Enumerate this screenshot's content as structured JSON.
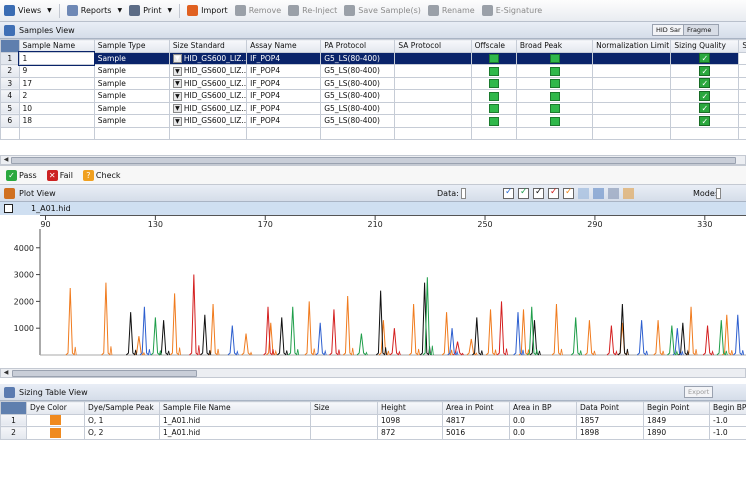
{
  "toolbar": {
    "items": [
      {
        "label": "Views",
        "icon": "views-icon",
        "color": "#3b6db3",
        "dropdown": true,
        "disabled": false
      },
      {
        "label": "Reports",
        "icon": "reports-icon",
        "color": "#6e88b5",
        "dropdown": true,
        "disabled": false
      },
      {
        "label": "Print",
        "icon": "print-icon",
        "color": "#5c6c86",
        "dropdown": true,
        "disabled": false
      },
      {
        "label": "Import",
        "icon": "import-icon",
        "color": "#e06020",
        "dropdown": false,
        "disabled": false
      },
      {
        "label": "Remove",
        "icon": "remove-icon",
        "color": "#9aa0a8",
        "dropdown": false,
        "disabled": true
      },
      {
        "label": "Re-Inject",
        "icon": "reinject-icon",
        "color": "#9aa0a8",
        "dropdown": false,
        "disabled": true
      },
      {
        "label": "Save Sample(s)",
        "icon": "save-icon",
        "color": "#9aa0a8",
        "dropdown": false,
        "disabled": true
      },
      {
        "label": "Rename",
        "icon": "rename-icon",
        "color": "#9aa0a8",
        "dropdown": false,
        "disabled": true
      },
      {
        "label": "E-Signature",
        "icon": "e-signature-icon",
        "color": "#9aa0a8",
        "dropdown": false,
        "disabled": true
      }
    ]
  },
  "samples_view": {
    "title": "Samples View",
    "hid_button": "HID Sar",
    "fragment_button": "Fragme",
    "columns": [
      "Sample Name",
      "Sample Type",
      "Size Standard",
      "Assay Name",
      "PA Protocol",
      "SA Protocol",
      "Offscale",
      "Broad Peak",
      "Normalization Limit",
      "Sizing Quality",
      "Sam"
    ],
    "rows": [
      {
        "n": "1",
        "name": "1",
        "type": "Sample",
        "std": "HID_GS600_LIZ...",
        "assay": "IF_POP4",
        "pa": "G5_LS(80-400)",
        "selected": true
      },
      {
        "n": "2",
        "name": "9",
        "type": "Sample",
        "std": "HID_GS600_LIZ...",
        "assay": "IF_POP4",
        "pa": "G5_LS(80-400)",
        "selected": false
      },
      {
        "n": "3",
        "name": "17",
        "type": "Sample",
        "std": "HID_GS600_LIZ...",
        "assay": "IF_POP4",
        "pa": "G5_LS(80-400)",
        "selected": false
      },
      {
        "n": "4",
        "name": "2",
        "type": "Sample",
        "std": "HID_GS600_LIZ...",
        "assay": "IF_POP4",
        "pa": "G5_LS(80-400)",
        "selected": false
      },
      {
        "n": "5",
        "name": "10",
        "type": "Sample",
        "std": "HID_GS600_LIZ...",
        "assay": "IF_POP4",
        "pa": "G5_LS(80-400)",
        "selected": false
      },
      {
        "n": "6",
        "name": "18",
        "type": "Sample",
        "std": "HID_GS600_LIZ...",
        "assay": "IF_POP4",
        "pa": "G5_LS(80-400)",
        "selected": false
      }
    ]
  },
  "legend": {
    "pass": "Pass",
    "fail": "Fail",
    "check": "Check",
    "pass_color": "#2aa83e",
    "fail_color": "#cc2222",
    "check_color": "#f0a020"
  },
  "plot_view": {
    "title": "Plot View",
    "data_label": "Data:",
    "mode_label": "Mode:",
    "sample_label": "1_A01.hid",
    "dye_toggle_colors": [
      "#2f6fd6",
      "#22a050",
      "#111111",
      "#d02020",
      "#f08a1e"
    ],
    "chart_data": {
      "type": "line",
      "xlabel": "",
      "ylabel": "",
      "x_ticks": [
        90,
        130,
        170,
        210,
        250,
        290,
        330
      ],
      "y_ticks": [
        1000,
        2000,
        3000,
        4000
      ],
      "xlim": [
        88,
        345
      ],
      "ylim": [
        0,
        4700
      ],
      "series": [
        {
          "color": "#f07b1e",
          "peaks": [
            [
              99,
              2500
            ],
            [
              112,
              2700
            ],
            [
              124,
              700
            ],
            [
              137,
              2300
            ],
            [
              151,
              1900
            ],
            [
              163,
              800
            ],
            [
              172,
              1200
            ],
            [
              186,
              2000
            ],
            [
              200,
              2200
            ],
            [
              213,
              1300
            ],
            [
              224,
              1900
            ],
            [
              236,
              1600
            ],
            [
              245,
              600
            ],
            [
              252,
              1700
            ],
            [
              264,
              1700
            ],
            [
              276,
              1900
            ],
            [
              288,
              1300
            ],
            [
              300,
              1200
            ],
            [
              313,
              1300
            ],
            [
              325,
              1800
            ],
            [
              338,
              1500
            ]
          ]
        },
        {
          "color": "#d42020",
          "peaks": [
            [
              144,
              3000
            ],
            [
              171,
              1800
            ],
            [
              195,
              1700
            ],
            [
              217,
              1000
            ],
            [
              240,
              500
            ],
            [
              256,
              2000
            ],
            [
              296,
              1100
            ],
            [
              331,
              1100
            ]
          ]
        },
        {
          "color": "#111111",
          "peaks": [
            [
              121,
              1600
            ],
            [
              133,
              1300
            ],
            [
              148,
              1500
            ],
            [
              176,
              1400
            ],
            [
              212,
              2400
            ],
            [
              228,
              2700
            ],
            [
              247,
              1400
            ],
            [
              268,
              1300
            ],
            [
              300,
              1900
            ],
            [
              322,
              1200
            ]
          ]
        },
        {
          "color": "#2d5fcf",
          "peaks": [
            [
              126,
              1800
            ],
            [
              158,
              1100
            ],
            [
              190,
              1200
            ],
            [
              238,
              1000
            ],
            [
              262,
              1600
            ],
            [
              307,
              1300
            ],
            [
              320,
              1000
            ],
            [
              342,
              1500
            ]
          ]
        },
        {
          "color": "#1f9e4a",
          "peaks": [
            [
              130,
              1400
            ],
            [
              180,
              1800
            ],
            [
              205,
              800
            ],
            [
              229,
              2900
            ],
            [
              267,
              1800
            ],
            [
              283,
              1400
            ],
            [
              318,
              1100
            ],
            [
              336,
              1300
            ]
          ]
        }
      ]
    }
  },
  "sizing_table": {
    "title": "Sizing Table View",
    "export": "Export",
    "columns": [
      "Dye Color",
      "Dye/Sample Peak",
      "Sample File Name",
      "Size",
      "Height",
      "Area in Point",
      "Area in BP",
      "Data Point",
      "Begin Point",
      "Begin BP"
    ],
    "dye_color": "#f08a1e",
    "rows": [
      {
        "n": "1",
        "peak": "O, 1",
        "file": "1_A01.hid",
        "size": "",
        "height": "1098",
        "area_pt": "4817",
        "area_bp": "0.0",
        "data_pt": "1857",
        "begin_pt": "1849",
        "begin_bp": "-1.0"
      },
      {
        "n": "2",
        "peak": "O, 2",
        "file": "1_A01.hid",
        "size": "",
        "height": "872",
        "area_pt": "5016",
        "area_bp": "0.0",
        "data_pt": "1898",
        "begin_pt": "1890",
        "begin_bp": "-1.0"
      }
    ]
  }
}
